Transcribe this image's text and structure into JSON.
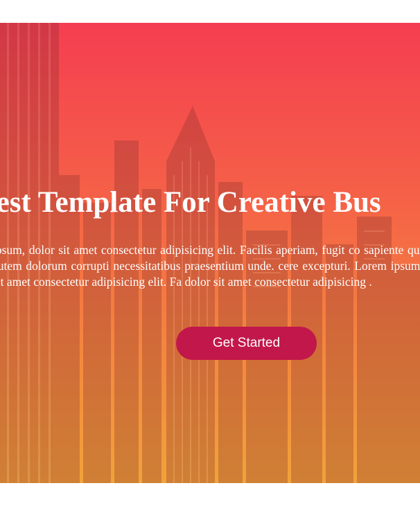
{
  "hero": {
    "title": "Best Template For Creative Bus",
    "paragraph": "ipsum, dolor sit amet consectetur adipisicing elit. Facilis aperiam, fugit co sapiente quis quo autem dolorum corrupti necessitatibus praesentium unde. cere excepturi. Lorem ipsum dolor sit amet consectetur adipisicing elit. Fa dolor sit amet consectetur adipisicing .",
    "cta_label": "Get Started"
  },
  "colors": {
    "gradient_top": "#f53e51",
    "gradient_bottom": "#f2a23a",
    "button": "#c2174a",
    "text": "#ffffff"
  }
}
